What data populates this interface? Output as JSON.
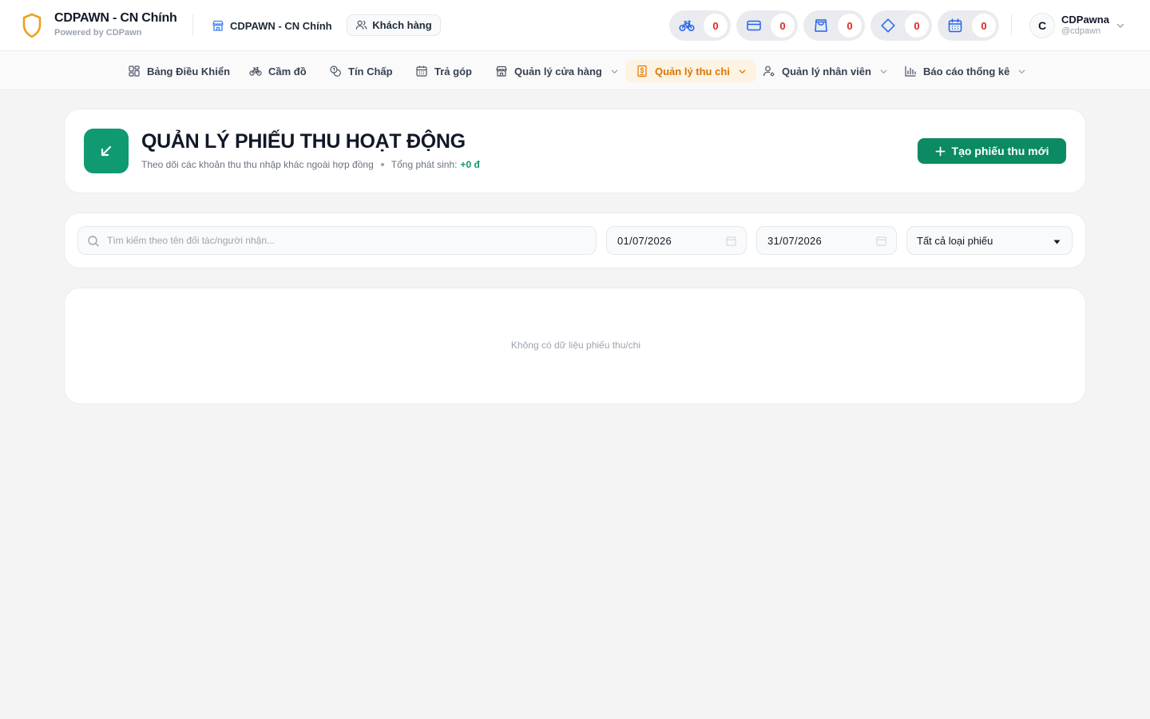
{
  "header": {
    "brand_title": "CDPAWN - CN Chính",
    "brand_subtitle": "Powered by CDPawn",
    "branch_name": "CDPAWN - CN Chính",
    "customers_label": "Khách hàng",
    "counters": [
      {
        "icon": "bicycle-icon",
        "count": "0"
      },
      {
        "icon": "credit-card-icon",
        "count": "0"
      },
      {
        "icon": "shopping-bag-icon",
        "count": "0"
      },
      {
        "icon": "diamond-icon",
        "count": "0"
      },
      {
        "icon": "calendar-icon",
        "count": "0"
      }
    ],
    "user": {
      "initial": "C",
      "name": "CDPawna",
      "handle": "@cdpawn"
    }
  },
  "nav": {
    "items": [
      {
        "label": "Bảng Điều Khiển",
        "icon": "dashboard-grid-icon"
      },
      {
        "label": "Cầm đồ",
        "icon": "bicycle-icon"
      },
      {
        "label": "Tín Chấp",
        "icon": "coins-icon"
      },
      {
        "label": "Trả góp",
        "icon": "calendar-icon"
      },
      {
        "label": "Quản lý cửa hàng",
        "icon": "store-icon",
        "has_dropdown": true
      },
      {
        "label": "Quản lý thu chi",
        "icon": "receipt-dollar-icon",
        "has_dropdown": true,
        "active": true
      },
      {
        "label": "Quản lý nhân viên",
        "icon": "user-cog-icon",
        "has_dropdown": true
      },
      {
        "label": "Báo cáo thống kê",
        "icon": "bar-chart-icon",
        "has_dropdown": true
      }
    ],
    "active_color": "#d97706"
  },
  "page": {
    "title": "QUẢN LÝ PHIẾU THU HOẠT ĐỘNG",
    "subtitle": "Theo dõi các khoản thu thu nhập khác ngoài hợp đồng",
    "total_label": "Tổng phát sinh:",
    "total_value": "+0 đ",
    "create_button": "Tạo phiếu thu mới",
    "accent_color": "#0f9a72"
  },
  "filters": {
    "search_placeholder": "Tìm kiếm theo tên đối tác/người nhận...",
    "search_value": "",
    "date_from": "01/07/2026",
    "date_to": "31/07/2026",
    "type_selected": "Tất cả loại phiếu"
  },
  "results": {
    "empty_message": "Không có dữ liệu phiếu thu/chi"
  }
}
